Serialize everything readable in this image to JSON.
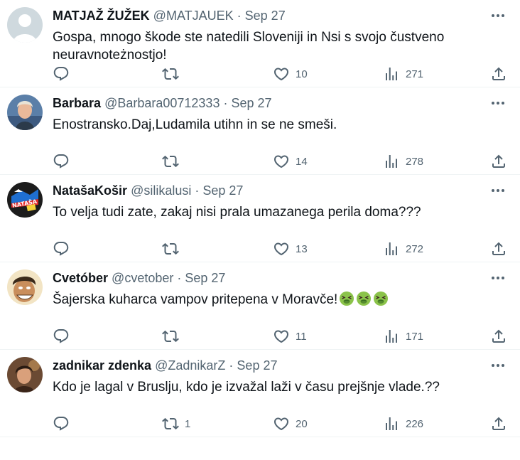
{
  "tweets": [
    {
      "name": "MATJAŽ ŽUŽEK",
      "handle": "@MATJAUEK",
      "sep": "·",
      "date": "Sep 27",
      "text": "Gospa, mnogo škode ste natedili Sloveniji in Nsi s svojo čustveno neuravnoteżnostjo!",
      "replies": "",
      "retweets": "",
      "likes": "10",
      "views": "271"
    },
    {
      "name": "Barbara",
      "handle": "@Barbara00712333",
      "sep": "·",
      "date": "Sep 27",
      "text": "Enostransko.Daj,Ludamila utihn in se ne smeši.",
      "replies": "",
      "retweets": "",
      "likes": "14",
      "views": "278"
    },
    {
      "name": "NatašaKošir",
      "handle": "@silikalusi",
      "sep": "·",
      "date": "Sep 27",
      "text": "To velja tudi zate, zakaj nisi prala umazanega perila doma???",
      "replies": "",
      "retweets": "",
      "likes": "13",
      "views": "272",
      "avatar_label": "NATAŠA"
    },
    {
      "name": "Cvetóber",
      "handle": "@cvetober",
      "sep": "·",
      "date": "Sep 27",
      "text": "Šajerska kuharca vampov pritepena v Moravče!",
      "emojis": [
        "nauseated-face",
        "nauseated-face",
        "nauseated-face"
      ],
      "replies": "",
      "retweets": "",
      "likes": "11",
      "views": "171"
    },
    {
      "name": "zadnikar zdenka",
      "handle": "@ZadnikarZ",
      "sep": "·",
      "date": "Sep 27",
      "text": "Kdo je lagal v Bruslju, kdo je izvažal laži v času prejšnje vlade.??",
      "replies": "",
      "retweets": "1",
      "likes": "20",
      "views": "226"
    }
  ],
  "colors": {
    "text": "#0f1419",
    "muted": "#536471",
    "divider": "#eff3f4",
    "emoji_face": "#8bc34a"
  }
}
